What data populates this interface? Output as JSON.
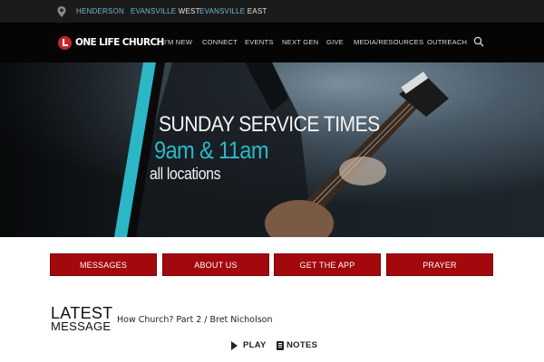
{
  "locations": {
    "henderson": {
      "a": "HENDERSON"
    },
    "evansville_west": {
      "a": "EVANSVILLE",
      "b": "WEST"
    },
    "evansville_east": {
      "a": "EVANSVILLE",
      "b": "EAST"
    }
  },
  "brand": {
    "name": "ONE LIFE CHURCH",
    "accent": "#c3272b"
  },
  "nav": {
    "items": [
      {
        "label": "I'M NEW"
      },
      {
        "label": "CONNECT"
      },
      {
        "label": "EVENTS"
      },
      {
        "label": "NEXT GEN"
      },
      {
        "label": "GIVE"
      },
      {
        "label": "MEDIA/RESOURCES"
      },
      {
        "label": "OUTREACH"
      }
    ],
    "search_icon": "search-icon"
  },
  "hero": {
    "title": "SUNDAY SERVICE TIMES",
    "times": "9am & 11am",
    "subtitle": "all locations",
    "accent": "#2bb7c6"
  },
  "buttons": [
    {
      "label": "MESSAGES"
    },
    {
      "label": "ABOUT US"
    },
    {
      "label": "GET THE APP"
    },
    {
      "label": "PRAYER"
    }
  ],
  "latest": {
    "heading_1": "LATEST",
    "heading_2": "MESSAGE",
    "title": "How Church? Part 2 / Bret Nicholson",
    "play_label": "PLAY",
    "notes_label": "NOTES"
  },
  "colors": {
    "button_red": "#a3080c",
    "link_blue": "#6fb7d3"
  }
}
